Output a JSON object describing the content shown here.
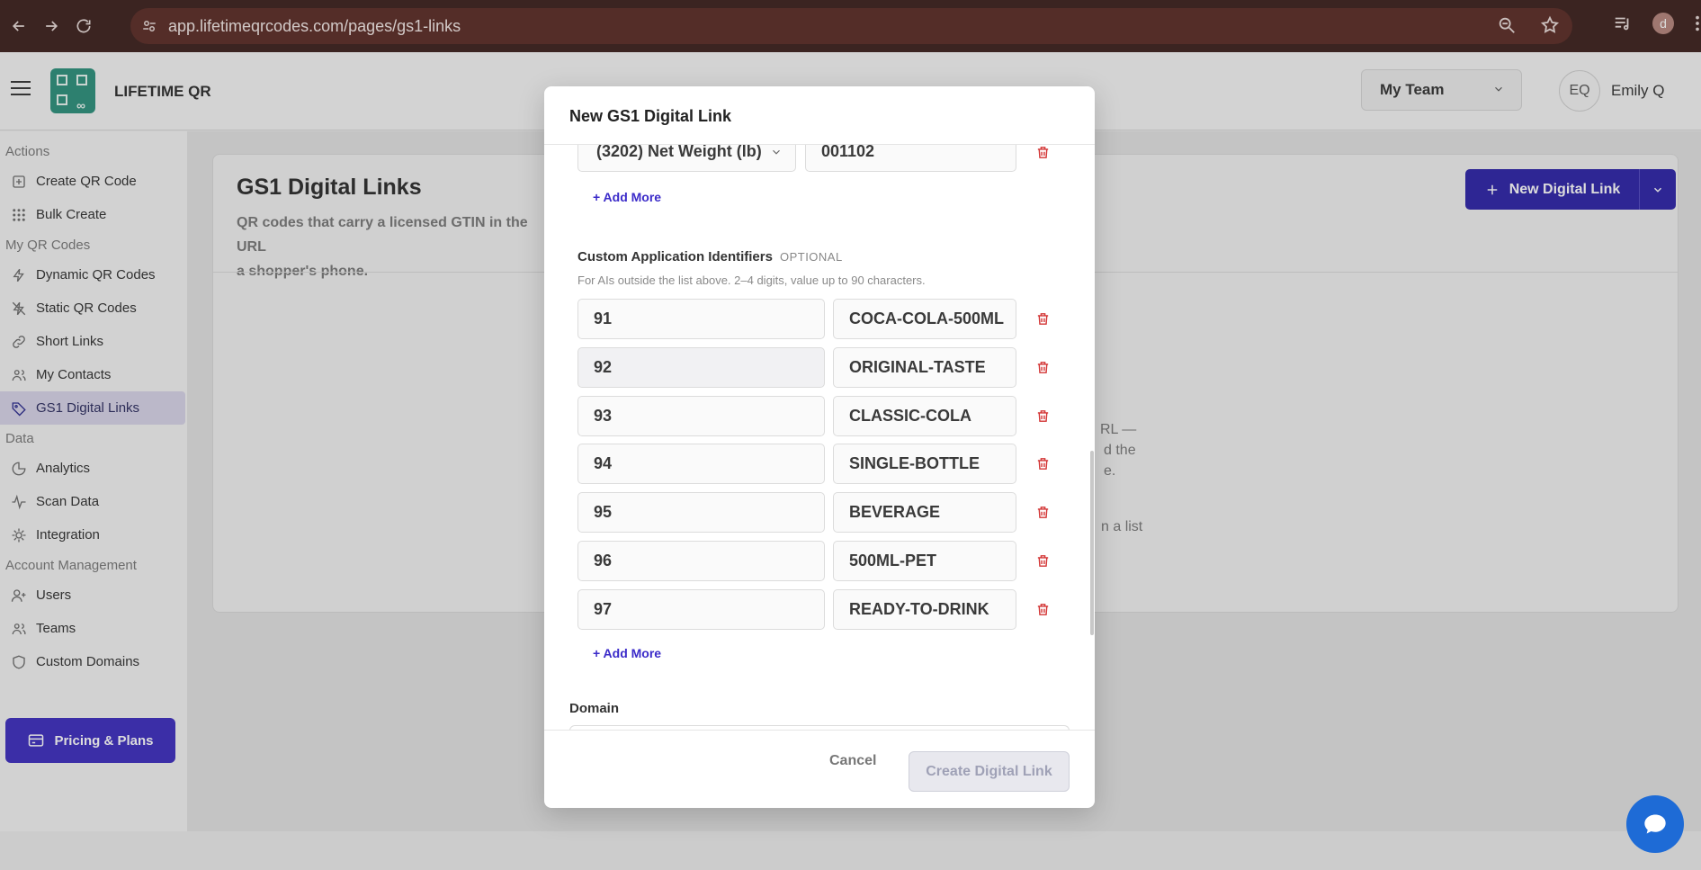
{
  "browser": {
    "url": "app.lifetimeqrcodes.com/pages/gs1-links",
    "profile_initial": "d"
  },
  "header": {
    "brand": "LIFETIME QR",
    "team_select": "My Team",
    "user_initials": "EQ",
    "user_name": "Emily Q"
  },
  "sidebar": {
    "sections": [
      {
        "title": "Actions",
        "items": [
          {
            "label": "Create QR Code",
            "icon": "plus-square-icon"
          },
          {
            "label": "Bulk Create",
            "icon": "grid-dots-icon"
          }
        ]
      },
      {
        "title": "My QR Codes",
        "items": [
          {
            "label": "Dynamic QR Codes",
            "icon": "bolt-icon"
          },
          {
            "label": "Static QR Codes",
            "icon": "bolt-off-icon"
          },
          {
            "label": "Short Links",
            "icon": "link-icon"
          },
          {
            "label": "My Contacts",
            "icon": "users-icon"
          },
          {
            "label": "GS1 Digital Links",
            "icon": "tag-icon",
            "active": true
          }
        ]
      },
      {
        "title": "Data",
        "items": [
          {
            "label": "Analytics",
            "icon": "pie-chart-icon"
          },
          {
            "label": "Scan Data",
            "icon": "activity-icon"
          },
          {
            "label": "Integration",
            "icon": "plug-icon"
          }
        ]
      },
      {
        "title": "Account Management",
        "items": [
          {
            "label": "Users",
            "icon": "user-plus-icon"
          },
          {
            "label": "Teams",
            "icon": "team-icon"
          },
          {
            "label": "Custom Domains",
            "icon": "shield-icon"
          }
        ]
      }
    ],
    "pricing_label": "Pricing & Plans"
  },
  "page": {
    "title": "GS1 Digital Links",
    "description": "QR codes that carry a licensed GTIN in the URL",
    "description_line2": "a shopper's phone.",
    "new_link_label": "New Digital Link",
    "bg_fragments": [
      "RL —",
      "d the",
      "e.",
      "n a list"
    ]
  },
  "modal": {
    "title": "New GS1 Digital Link",
    "top_row": {
      "ai_select": "(3202) Net Weight (lb)",
      "value": "001102"
    },
    "add_more_label": "+ Add More",
    "custom_section": {
      "label": "Custom Application Identifiers",
      "optional": "OPTIONAL",
      "hint": "For AIs outside the list above. 2–4 digits, value up to 90 characters.",
      "rows": [
        {
          "ai": "91",
          "value": "COCA-COLA-500ML"
        },
        {
          "ai": "92",
          "value": "ORIGINAL-TASTE"
        },
        {
          "ai": "93",
          "value": "CLASSIC-COLA"
        },
        {
          "ai": "94",
          "value": "SINGLE-BOTTLE"
        },
        {
          "ai": "95",
          "value": "BEVERAGE"
        },
        {
          "ai": "96",
          "value": "500ML-PET"
        },
        {
          "ai": "97",
          "value": "READY-TO-DRINK"
        }
      ]
    },
    "domain_label": "Domain",
    "cancel_label": "Cancel",
    "create_label": "Create Digital Link"
  }
}
